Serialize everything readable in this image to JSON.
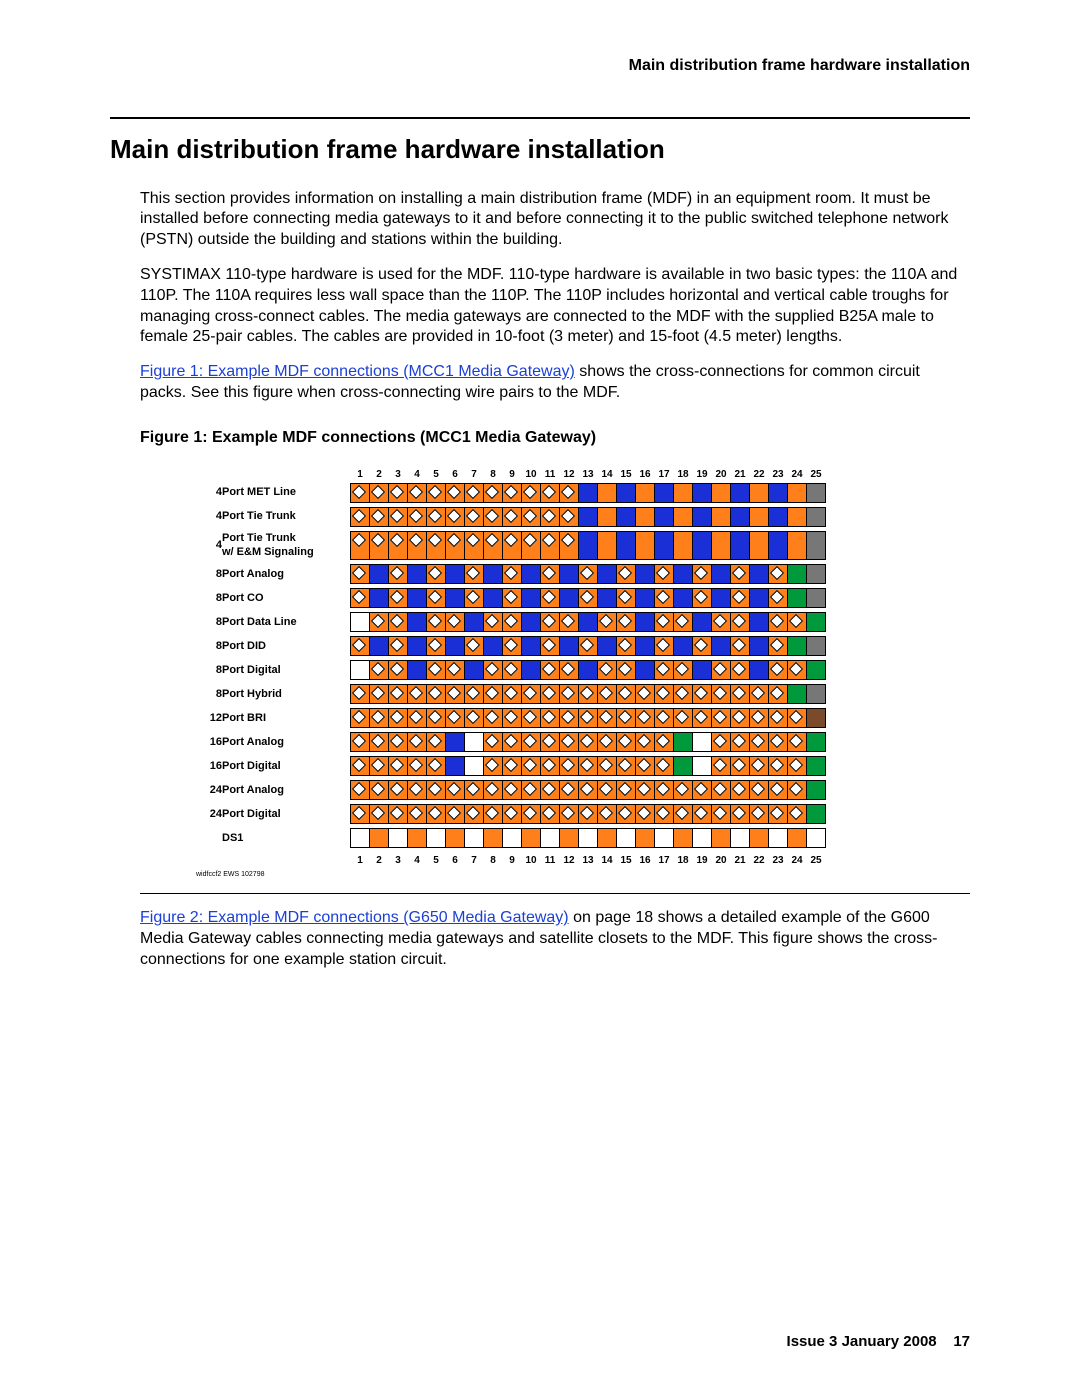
{
  "running_head": "Main distribution frame hardware installation",
  "h1": "Main distribution frame hardware installation",
  "para1": "This section provides information on installing a main distribution frame (MDF) in an equipment room. It must be installed before connecting media gateways to it and before connecting it to the public switched telephone network (PSTN) outside the building and stations within the building.",
  "para2": "SYSTIMAX 110-type hardware is used for the MDF. 110-type hardware is available in two basic types: the 110A and 110P. The 110A requires less wall space than the 110P. The 110P includes horizontal and vertical cable troughs for managing cross-connect cables. The media gateways are connected to the MDF with the supplied B25A male to female 25-pair cables. The cables are provided in 10-foot (3 meter) and 15-foot (4.5 meter) lengths.",
  "link1": "Figure 1:  Example MDF connections (MCC1 Media Gateway)",
  "para3_tail": " shows the cross-connections for common circuit packs. See this figure when cross-connecting wire pairs to the MDF.",
  "fig_title": "Figure 1: Example MDF connections (MCC1 Media Gateway)",
  "fig_footnote": "widfccf2 EWS 102798",
  "link2": "Figure 2:  Example MDF connections (G650 Media Gateway)",
  "para4_tail": " on page 18 shows a detailed example of the G600 Media Gateway cables connecting media gateways and satellite closets to the MDF. This figure shows the cross-connections for one example station circuit.",
  "footer_issue": "Issue 3    January 2008",
  "footer_page": "17",
  "chart_data": {
    "type": "table",
    "axis": [
      "1",
      "2",
      "3",
      "4",
      "5",
      "6",
      "7",
      "8",
      "9",
      "10",
      "11",
      "12",
      "13",
      "14",
      "15",
      "16",
      "17",
      "18",
      "19",
      "20",
      "21",
      "22",
      "23",
      "24",
      "25"
    ],
    "legend": {
      "W": "white",
      "O": "orange",
      "G": "green",
      "B": "blue",
      "Br": "brown",
      "Gr": "grey",
      "d": "diamond-marker"
    },
    "rows": [
      {
        "count": "4",
        "label": "Port MET Line",
        "cells": [
          "Od",
          "Od",
          "Od",
          "Od",
          "Od",
          "Od",
          "Od",
          "Od",
          "Od",
          "Od",
          "Od",
          "Od",
          "B",
          "O",
          "B",
          "O",
          "B",
          "O",
          "B",
          "O",
          "B",
          "O",
          "B",
          "O",
          "Gr"
        ]
      },
      {
        "count": "4",
        "label": "Port Tie Trunk",
        "cells": [
          "Od",
          "Od",
          "Od",
          "Od",
          "Od",
          "Od",
          "Od",
          "Od",
          "Od",
          "Od",
          "Od",
          "Od",
          "B",
          "O",
          "B",
          "O",
          "B",
          "O",
          "B",
          "O",
          "B",
          "O",
          "B",
          "O",
          "Gr"
        ]
      },
      {
        "count": "4",
        "label": "Port Tie Trunk\nw/ E&M Signaling",
        "cells": [
          "Od",
          "Od",
          "Od",
          "Od",
          "Od",
          "Od",
          "Od",
          "Od",
          "Od",
          "Od",
          "Od",
          "Od",
          "B",
          "O",
          "B",
          "O",
          "B",
          "O",
          "B",
          "O",
          "B",
          "O",
          "B",
          "O",
          "Gr"
        ]
      },
      {
        "count": "8",
        "label": "Port Analog",
        "cells": [
          "Od",
          "B",
          "Od",
          "B",
          "Od",
          "B",
          "Od",
          "B",
          "Od",
          "B",
          "Od",
          "B",
          "Od",
          "B",
          "Od",
          "B",
          "Od",
          "B",
          "Od",
          "B",
          "Od",
          "B",
          "Od",
          "G",
          "Gr"
        ]
      },
      {
        "count": "8",
        "label": "Port CO",
        "cells": [
          "Od",
          "B",
          "Od",
          "B",
          "Od",
          "B",
          "Od",
          "B",
          "Od",
          "B",
          "Od",
          "B",
          "Od",
          "B",
          "Od",
          "B",
          "Od",
          "B",
          "Od",
          "B",
          "Od",
          "B",
          "Od",
          "G",
          "Gr"
        ]
      },
      {
        "count": "8",
        "label": "Port Data Line",
        "cells": [
          "W",
          "Od",
          "Od",
          "B",
          "Od",
          "Od",
          "B",
          "Od",
          "Od",
          "B",
          "Od",
          "Od",
          "B",
          "Od",
          "Od",
          "B",
          "Od",
          "Od",
          "B",
          "Od",
          "Od",
          "B",
          "Od",
          "Od",
          "G"
        ]
      },
      {
        "count": "8",
        "label": "Port DID",
        "cells": [
          "Od",
          "B",
          "Od",
          "B",
          "Od",
          "B",
          "Od",
          "B",
          "Od",
          "B",
          "Od",
          "B",
          "Od",
          "B",
          "Od",
          "B",
          "Od",
          "B",
          "Od",
          "B",
          "Od",
          "B",
          "Od",
          "G",
          "Gr"
        ]
      },
      {
        "count": "8",
        "label": "Port Digital",
        "cells": [
          "W",
          "Od",
          "Od",
          "B",
          "Od",
          "Od",
          "B",
          "Od",
          "Od",
          "B",
          "Od",
          "Od",
          "B",
          "Od",
          "Od",
          "B",
          "Od",
          "Od",
          "B",
          "Od",
          "Od",
          "B",
          "Od",
          "Od",
          "G"
        ]
      },
      {
        "count": "8",
        "label": "Port Hybrid",
        "cells": [
          "Od",
          "Od",
          "Od",
          "Od",
          "Od",
          "Od",
          "Od",
          "Od",
          "Od",
          "Od",
          "Od",
          "Od",
          "Od",
          "Od",
          "Od",
          "Od",
          "Od",
          "Od",
          "Od",
          "Od",
          "Od",
          "Od",
          "Od",
          "G",
          "Gr"
        ]
      },
      {
        "count": "12",
        "label": "Port BRI",
        "cells": [
          "Od",
          "Od",
          "Od",
          "Od",
          "Od",
          "Od",
          "Od",
          "Od",
          "Od",
          "Od",
          "Od",
          "Od",
          "Od",
          "Od",
          "Od",
          "Od",
          "Od",
          "Od",
          "Od",
          "Od",
          "Od",
          "Od",
          "Od",
          "Od",
          "Br"
        ]
      },
      {
        "count": "16",
        "label": "Port Analog",
        "cells": [
          "Od",
          "Od",
          "Od",
          "Od",
          "Od",
          "B",
          "W",
          "Od",
          "Od",
          "Od",
          "Od",
          "Od",
          "Od",
          "Od",
          "Od",
          "Od",
          "Od",
          "G",
          "W",
          "Od",
          "Od",
          "Od",
          "Od",
          "Od",
          "G"
        ]
      },
      {
        "count": "16",
        "label": "Port Digital",
        "cells": [
          "Od",
          "Od",
          "Od",
          "Od",
          "Od",
          "B",
          "W",
          "Od",
          "Od",
          "Od",
          "Od",
          "Od",
          "Od",
          "Od",
          "Od",
          "Od",
          "Od",
          "G",
          "W",
          "Od",
          "Od",
          "Od",
          "Od",
          "Od",
          "G"
        ]
      },
      {
        "count": "24",
        "label": "Port Analog",
        "cells": [
          "Od",
          "Od",
          "Od",
          "Od",
          "Od",
          "Od",
          "Od",
          "Od",
          "Od",
          "Od",
          "Od",
          "Od",
          "Od",
          "Od",
          "Od",
          "Od",
          "Od",
          "Od",
          "Od",
          "Od",
          "Od",
          "Od",
          "Od",
          "Od",
          "G"
        ]
      },
      {
        "count": "24",
        "label": "Port Digital",
        "cells": [
          "Od",
          "Od",
          "Od",
          "Od",
          "Od",
          "Od",
          "Od",
          "Od",
          "Od",
          "Od",
          "Od",
          "Od",
          "Od",
          "Od",
          "Od",
          "Od",
          "Od",
          "Od",
          "Od",
          "Od",
          "Od",
          "Od",
          "Od",
          "Od",
          "G"
        ]
      },
      {
        "count": "",
        "label": "DS1",
        "cells": [
          "W",
          "O",
          "W",
          "O",
          "W",
          "O",
          "W",
          "O",
          "W",
          "O",
          "W",
          "O",
          "W",
          "O",
          "W",
          "O",
          "W",
          "O",
          "W",
          "O",
          "W",
          "O",
          "W",
          "O",
          "W"
        ]
      }
    ]
  }
}
